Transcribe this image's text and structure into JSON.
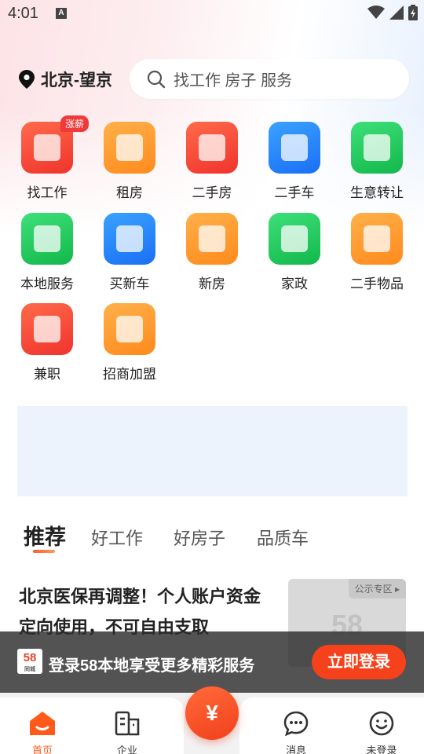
{
  "status_bar": {
    "time": "4:01",
    "notif_letter": "A"
  },
  "header": {
    "location": "北京-望京",
    "search_placeholder": "找工作 房子 服务"
  },
  "grid": [
    {
      "label": "找工作",
      "badge": "涨薪",
      "icon": "job-icon",
      "color": "red"
    },
    {
      "label": "租房",
      "icon": "sofa-icon",
      "color": "orange"
    },
    {
      "label": "二手房",
      "icon": "house-icon",
      "color": "red"
    },
    {
      "label": "二手车",
      "icon": "car-icon",
      "color": "blue"
    },
    {
      "label": "生意转让",
      "icon": "transfer-icon",
      "color": "green"
    },
    {
      "label": "本地服务",
      "icon": "local-service-icon",
      "color": "green"
    },
    {
      "label": "买新车",
      "icon": "new-car-icon",
      "color": "blue"
    },
    {
      "label": "新房",
      "icon": "building-icon",
      "color": "orange"
    },
    {
      "label": "家政",
      "icon": "housekeeping-icon",
      "color": "green"
    },
    {
      "label": "二手物品",
      "icon": "star-box-icon",
      "color": "orange"
    },
    {
      "label": "兼职",
      "icon": "part-time-icon",
      "color": "red"
    },
    {
      "label": "招商加盟",
      "icon": "franchise-icon",
      "color": "orange"
    }
  ],
  "tabs": [
    {
      "label": "推荐",
      "active": true
    },
    {
      "label": "好工作"
    },
    {
      "label": "好房子"
    },
    {
      "label": "品质车"
    }
  ],
  "article": {
    "title": "北京医保再调整！个人账户资金定向使用，不可自由支取",
    "thumb_tag": "公示专区 ▸",
    "thumb_logo": "58"
  },
  "login_bar": {
    "logo_text": "58",
    "logo_sub": "同城",
    "text": "登录58本地享受更多精彩服务",
    "button": "立即登录"
  },
  "bottom_nav": {
    "items": [
      {
        "label": "首页",
        "icon": "home-icon",
        "active": true
      },
      {
        "label": "企业",
        "icon": "enterprise-icon"
      },
      {
        "label": "消息",
        "icon": "message-icon"
      },
      {
        "label": "未登录",
        "icon": "profile-icon"
      }
    ],
    "center_symbol": "¥"
  },
  "colors": {
    "accent": "#f5421c",
    "active_nav": "#ff5a1a",
    "banner": "#edf3fc"
  }
}
